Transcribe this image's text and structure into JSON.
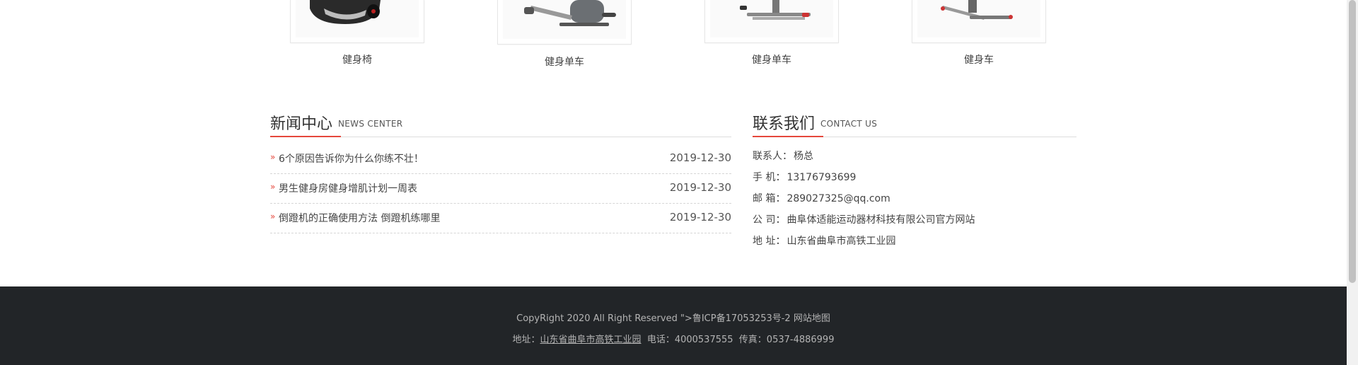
{
  "products": [
    {
      "caption": "健身椅",
      "icon": "fitness-bench-image"
    },
    {
      "caption": "健身单车",
      "icon": "exercise-bike-image"
    },
    {
      "caption": "健身单车",
      "icon": "exercise-bike-image"
    },
    {
      "caption": "健身车",
      "icon": "fitness-bike-image"
    }
  ],
  "news": {
    "title_cn": "新闻中心",
    "title_en": "NEWS CENTER",
    "items": [
      {
        "title": "6个原因告诉你为什么你练不壮！",
        "date": "2019-12-30"
      },
      {
        "title": "男生健身房健身增肌计划一周表",
        "date": "2019-12-30"
      },
      {
        "title": "倒蹬机的正确使用方法 倒蹬机练哪里",
        "date": "2019-12-30"
      }
    ]
  },
  "contact": {
    "title_cn": "联系我们",
    "title_en": "CONTACT US",
    "lines": [
      {
        "label": "联系人：",
        "value": "杨总"
      },
      {
        "label": "手 机：",
        "value": "13176793699"
      },
      {
        "label": "邮 箱：",
        "value": "289027325@qq.com"
      },
      {
        "label": "公 司：",
        "value": "曲阜体适能运动器材科技有限公司官方网站"
      },
      {
        "label": "地 址：",
        "value": "山东省曲阜市高铁工业园"
      }
    ]
  },
  "footer": {
    "copyright": "CopyRight 2020 All Right Reserved \">鲁ICP备17053253号-2",
    "sitemap": "网站地图",
    "address_label": "地址：",
    "address_link": "山东省曲阜市高铁工业园",
    "phone": "电话：4000537555",
    "fax": "传真：0537-4886999"
  },
  "colors": {
    "accent": "#e5473c",
    "footer_bg": "#222528"
  }
}
